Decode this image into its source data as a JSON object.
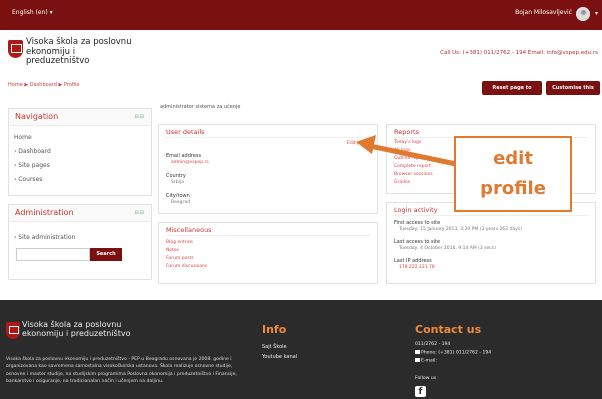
{
  "topbar": {
    "language": "English (en) ▾",
    "user_name": "Bojan Milosavljević",
    "caret": "▾"
  },
  "brand": {
    "name": "Visoka škola za poslovnu ekonomiju i preduzetništvo",
    "contact": "Call Us: (+381) 011/2762 - 194  Email: info@vspep.edu.rs"
  },
  "breadcrumb": "Home ▶ Dashboard ▶ Profile",
  "buttons": {
    "reset": "Reset page to default",
    "customise": "Customise this page"
  },
  "navigation": {
    "title": "Navigation",
    "controls": "⊟⊟",
    "items": [
      "Home",
      "› Dashboard",
      "› Site pages",
      "› Courses"
    ]
  },
  "administration": {
    "title": "Administration",
    "controls": "⊟⊟",
    "items": [
      "› Site administration"
    ],
    "search_button": "Search"
  },
  "profile": {
    "user_heading": "administrator sistema za učenje",
    "user_details": {
      "title": "User details",
      "edit_link": "Edit profile",
      "email_label": "Email address",
      "email_value": "admin@vspep.rs",
      "country_label": "Country",
      "country_value": "Srbija",
      "city_label": "City/town",
      "city_value": "Beograd"
    },
    "miscellaneous": {
      "title": "Miscellaneous",
      "links": [
        "Blog entries",
        "Notes",
        "Forum posts",
        "Forum discussions"
      ]
    },
    "reports": {
      "title": "Reports",
      "links": [
        "Today's logs",
        "All logs",
        "Outline report",
        "Complete report",
        "Browser sessions",
        "Grades"
      ]
    },
    "login_activity": {
      "title": "Login activity",
      "first_label": "First access to site",
      "first_value": "Tuesday, 15 January 2013, 3:30 PM  (3 years 262 days)",
      "last_label": "Last access to site",
      "last_value": "Tuesday, 4 October 2016, 9:14 AM  (3 secs)",
      "ip_label": "Last IP address",
      "ip_value": "178.222.221.78"
    }
  },
  "annotation": {
    "line1": "edit",
    "line2": "profile",
    "color": "#e07a30"
  },
  "footer": {
    "name": "Visoka škola za poslovnu ekonomiju i preduzetništvo",
    "about": "Visoka škola za poslovnu ekonomiju i preduzetništvo - PEP u Beogradu osnovana je 2008. godine i organizovana kao savremena samostalna visokoškolska ustanova. Škola realizuje osnovne studije, osnovne i master studije, na studijskim programima Poslovna ekonomija i preduzetništvo i Finansije, bankarstvo i osiguranje, na tradicionalan način i učenjem na daljinu.",
    "info_title": "Info",
    "info_links": [
      "Sajt Škole",
      "Youtube kanal"
    ],
    "contact_title": "Contact us",
    "contact_lines": [
      "011/2762 - 194",
      "Phone: (+381) 011/2762 - 194",
      "E-mail:"
    ],
    "follow": "Follow us",
    "facebook": "f"
  },
  "colors": {
    "brand": "#7a1010",
    "accent": "#f08a3a",
    "link": "#d44444"
  }
}
